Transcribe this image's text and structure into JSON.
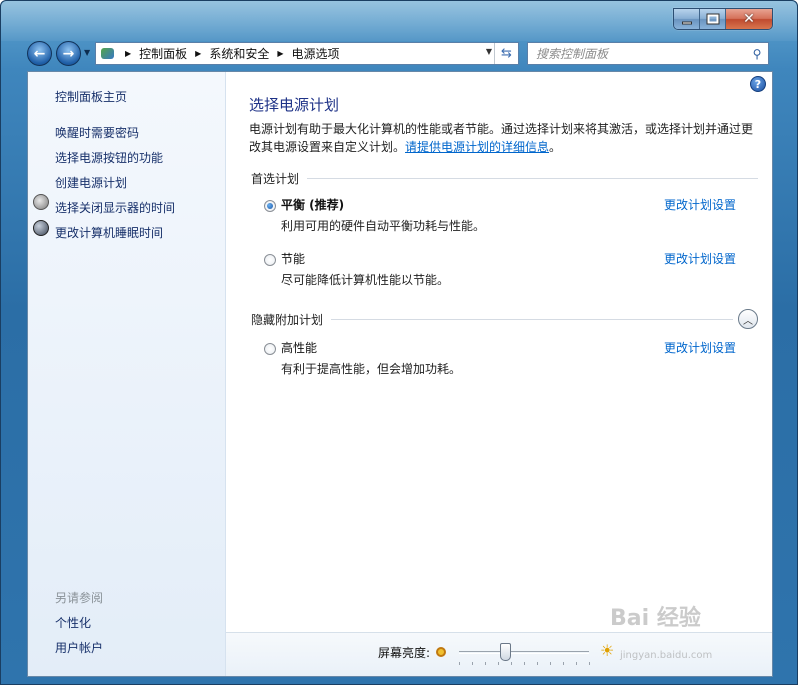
{
  "window": {
    "caption": {
      "minimize": "–",
      "maximize": "□",
      "close": "✕"
    }
  },
  "nav": {
    "back": "←",
    "forward": "→",
    "breadcrumbs": [
      "控制面板",
      "系统和安全",
      "电源选项"
    ],
    "search_placeholder": "搜索控制面板"
  },
  "sidebar": {
    "home": "控制面板主页",
    "links": [
      "唤醒时需要密码",
      "选择电源按钮的功能",
      "创建电源计划",
      "选择关闭显示器的时间",
      "更改计算机睡眠时间"
    ],
    "see_also_header": "另请参阅",
    "see_also": [
      "个性化",
      "用户帐户"
    ]
  },
  "main": {
    "title": "选择电源计划",
    "description": "电源计划有助于最大化计算机的性能或者节能。通过选择计划来将其激活，或选择计划并通过更改其电源设置来自定义计划。",
    "description_link": "请提供电源计划的详细信息",
    "description_end": "。",
    "preferred_header": "首选计划",
    "hidden_header": "隐藏附加计划",
    "plans": [
      {
        "name": "平衡 (推荐)",
        "desc": "利用可用的硬件自动平衡功耗与性能。",
        "link": "更改计划设置",
        "selected": true
      },
      {
        "name": "节能",
        "desc": "尽可能降低计算机性能以节能。",
        "link": "更改计划设置",
        "selected": false
      },
      {
        "name": "高性能",
        "desc": "有利于提高性能，但会增加功耗。",
        "link": "更改计划设置",
        "selected": false
      }
    ]
  },
  "brightness": {
    "label": "屏幕亮度:",
    "level": 0.35
  },
  "watermark": {
    "text": "Bai 经验",
    "sub": "jingyan.baidu.com"
  }
}
